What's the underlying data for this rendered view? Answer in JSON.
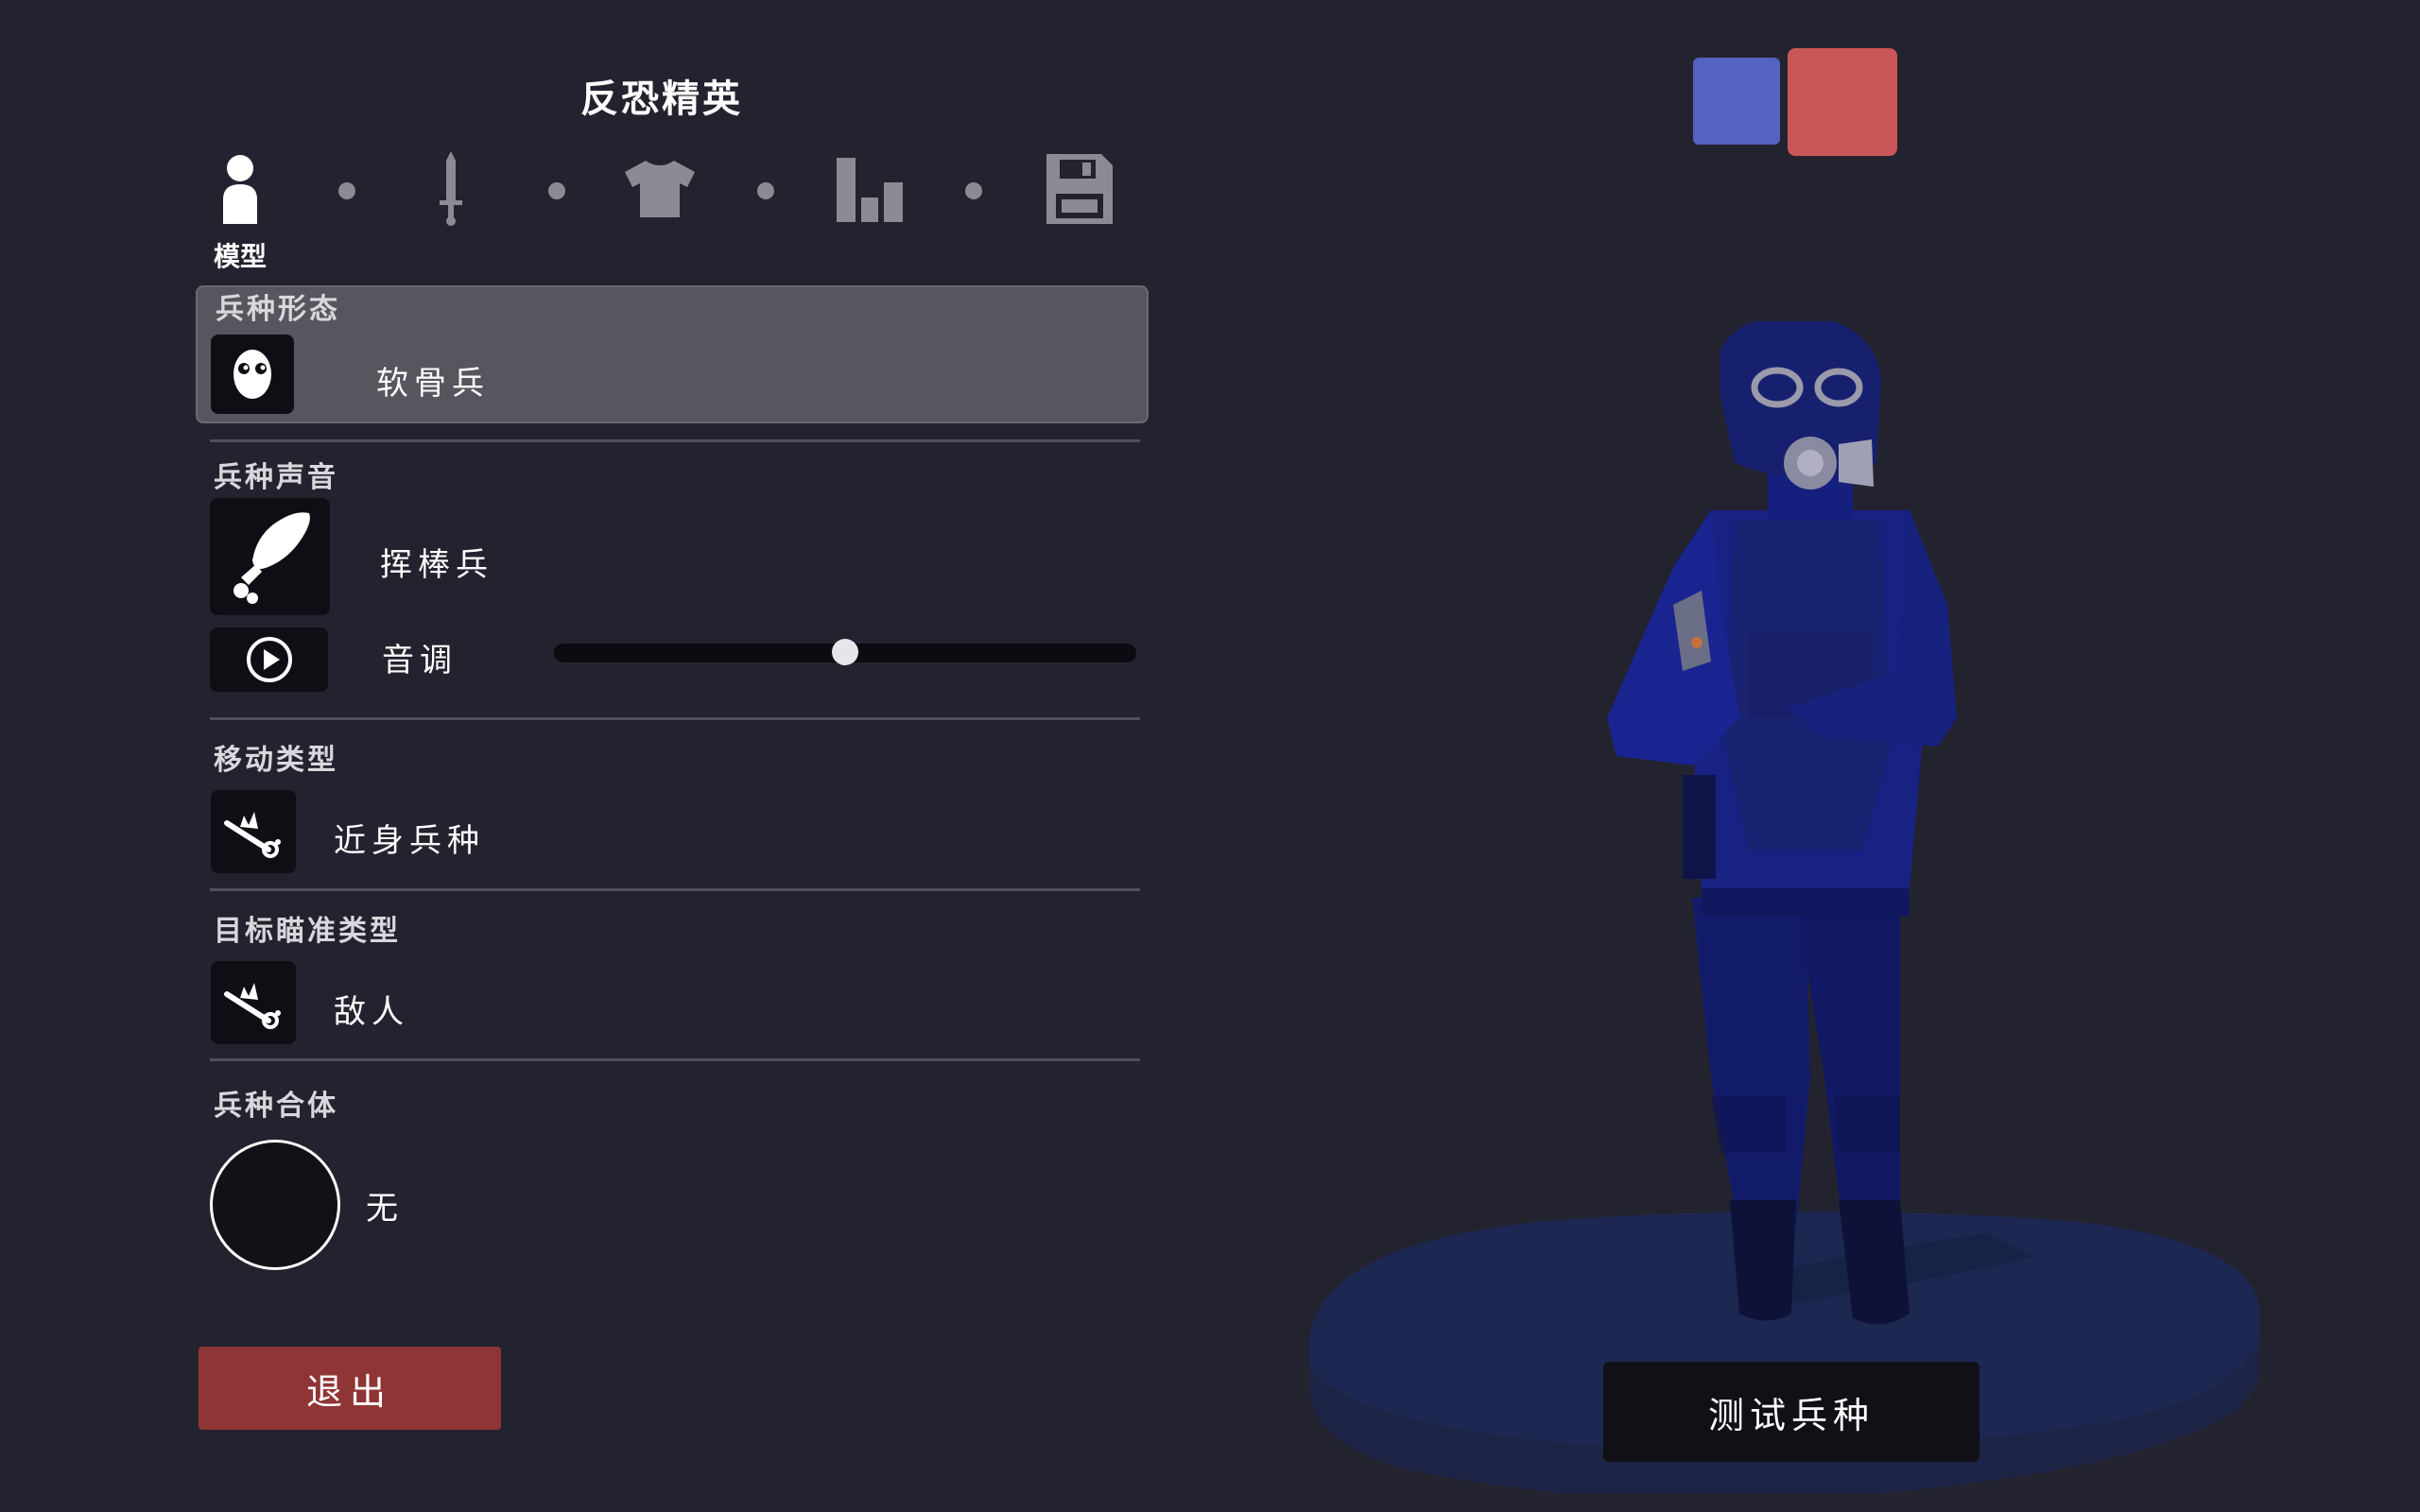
{
  "unit": {
    "name": "反恐精英"
  },
  "tabs": [
    {
      "icon": "person-icon",
      "label": "模型",
      "active": true
    },
    {
      "icon": "sword-icon",
      "active": false
    },
    {
      "icon": "shirt-icon",
      "active": false
    },
    {
      "icon": "bar-chart-icon",
      "active": false
    },
    {
      "icon": "save-icon",
      "active": false
    }
  ],
  "sections": {
    "form": {
      "label": "兵种形态",
      "value": "软骨兵",
      "icon": "bone-face-icon"
    },
    "voice": {
      "label": "兵种声音",
      "value": "挥棒兵",
      "icon": "club-icon",
      "pitch_label": "音调",
      "pitch_value": 0.5,
      "play_icon": "play-icon"
    },
    "movement": {
      "label": "移动类型",
      "value": "近身兵种",
      "icon": "melee-icon"
    },
    "targeting": {
      "label": "目标瞄准类型",
      "value": "敌人",
      "icon": "melee-icon"
    },
    "combo": {
      "label": "兵种合体",
      "value": "无"
    }
  },
  "buttons": {
    "exit": "退出",
    "test": "测试兵种"
  },
  "teams": {
    "blue_color": "#5463c2",
    "red_color": "#c95757"
  },
  "colors": {
    "background": "#232330",
    "exit": "#8f3535",
    "selected_card": "#56565e"
  }
}
